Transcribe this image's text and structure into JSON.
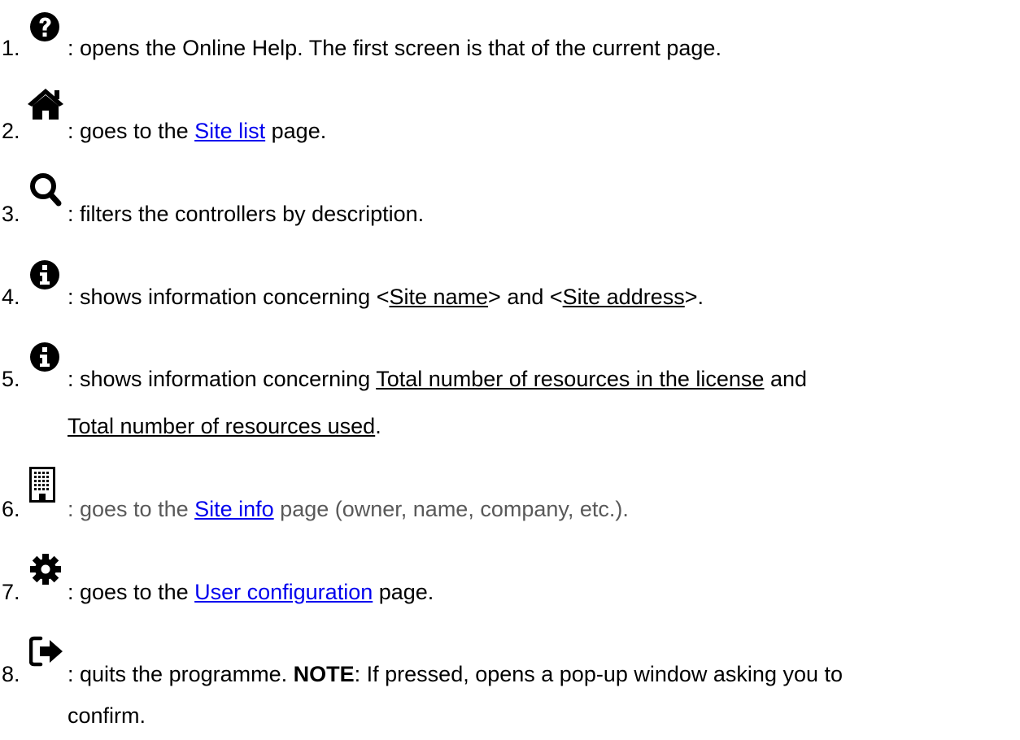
{
  "items": [
    {
      "number": "1.",
      "icon": "question-circle-icon",
      "text": ": opens the Online Help. The first screen is that of the current page."
    },
    {
      "number": "2.",
      "icon": "home-icon",
      "before": ": goes to the ",
      "link": "Site list",
      "after": " page."
    },
    {
      "number": "3.",
      "icon": "search-icon",
      "text": ": filters the controllers by description."
    },
    {
      "number": "4.",
      "icon": "info-circle-icon",
      "before": ": shows information concerning <",
      "u1": "Site name",
      "mid": "> and <",
      "u2": "Site address",
      "after": ">."
    },
    {
      "number": "5.",
      "icon": "info-circle-icon",
      "before": ": shows information concerning ",
      "u1": "Total number of resources in the license",
      "mid": " and",
      "u2": "Total number of resources used",
      "after": "."
    },
    {
      "number": "6.",
      "icon": "building-icon",
      "before": ": goes to the ",
      "link": "Site info",
      "after": " page (owner, name, company, etc.)."
    },
    {
      "number": "7.",
      "icon": "gear-icon",
      "before": ": goes to the ",
      "link": "User configuration",
      "after": " page."
    },
    {
      "number": "8.",
      "icon": "sign-out-icon",
      "before": ": quits the programme. ",
      "bold": "NOTE",
      "after": ": If pressed, opens a pop-up window asking you to",
      "line2": "confirm."
    }
  ]
}
